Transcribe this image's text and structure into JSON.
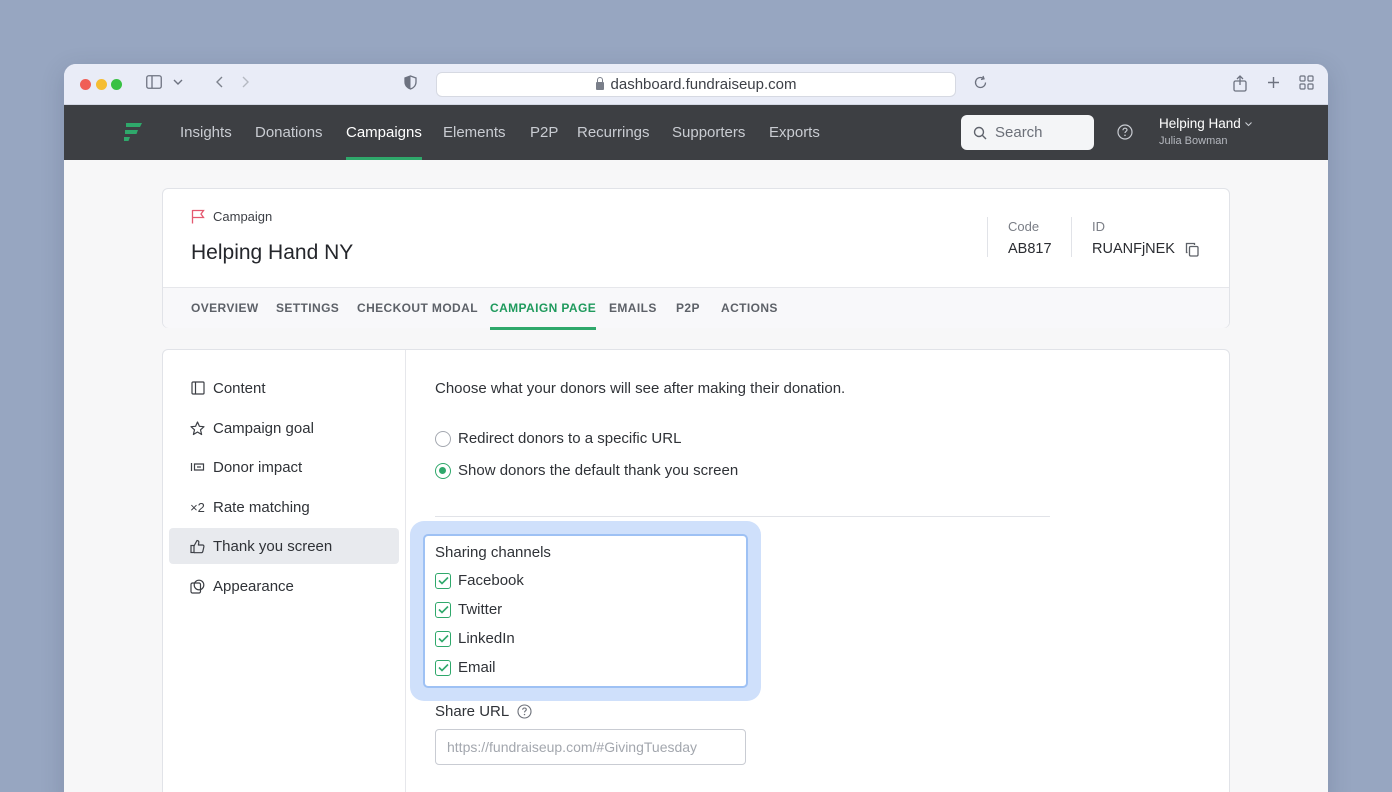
{
  "browser": {
    "url": "dashboard.fundraiseup.com"
  },
  "nav": {
    "items": [
      {
        "label": "Insights",
        "active": false
      },
      {
        "label": "Donations",
        "active": false
      },
      {
        "label": "Campaigns",
        "active": true
      },
      {
        "label": "Elements",
        "active": false
      },
      {
        "label": "P2P",
        "active": false
      },
      {
        "label": "Recurrings",
        "active": false
      },
      {
        "label": "Supporters",
        "active": false
      },
      {
        "label": "Exports",
        "active": false
      }
    ],
    "search_placeholder": "Search",
    "org_name": "Helping Hand",
    "user_name": "Julia Bowman"
  },
  "campaign": {
    "kind_label": "Campaign",
    "title": "Helping Hand NY",
    "code_label": "Code",
    "code_value": "AB817",
    "id_label": "ID",
    "id_value": "RUANFjNEK"
  },
  "tabs": [
    {
      "label": "OVERVIEW",
      "active": false
    },
    {
      "label": "SETTINGS",
      "active": false
    },
    {
      "label": "CHECKOUT MODAL",
      "active": false
    },
    {
      "label": "CAMPAIGN PAGE",
      "active": true
    },
    {
      "label": "EMAILS",
      "active": false
    },
    {
      "label": "P2P",
      "active": false
    },
    {
      "label": "ACTIONS",
      "active": false
    }
  ],
  "sidebar": {
    "items": [
      {
        "label": "Content",
        "icon": "layout-icon",
        "active": false
      },
      {
        "label": "Campaign goal",
        "icon": "star-icon",
        "active": false
      },
      {
        "label": "Donor impact",
        "icon": "impact-icon",
        "active": false
      },
      {
        "label": "Rate matching",
        "icon": "x2-icon",
        "active": false
      },
      {
        "label": "Thank you screen",
        "icon": "thumbs-up-icon",
        "active": true
      },
      {
        "label": "Appearance",
        "icon": "appearance-icon",
        "active": false
      }
    ]
  },
  "thankyou": {
    "intro": "Choose what your donors will see after making their donation.",
    "options": [
      {
        "label": "Redirect donors to a specific URL",
        "selected": false
      },
      {
        "label": "Show donors the default thank you screen",
        "selected": true
      }
    ],
    "sharing_title": "Sharing channels",
    "channels": [
      {
        "label": "Facebook",
        "checked": true
      },
      {
        "label": "Twitter",
        "checked": true
      },
      {
        "label": "LinkedIn",
        "checked": true
      },
      {
        "label": "Email",
        "checked": true
      }
    ],
    "share_url_label": "Share URL",
    "share_url_placeholder": "https://fundraiseup.com/#GivingTuesday",
    "share_url_value": ""
  },
  "colors": {
    "accent": "#2fa86b",
    "nav_bg": "#3d3f43",
    "highlight": "#cfe0fb"
  }
}
